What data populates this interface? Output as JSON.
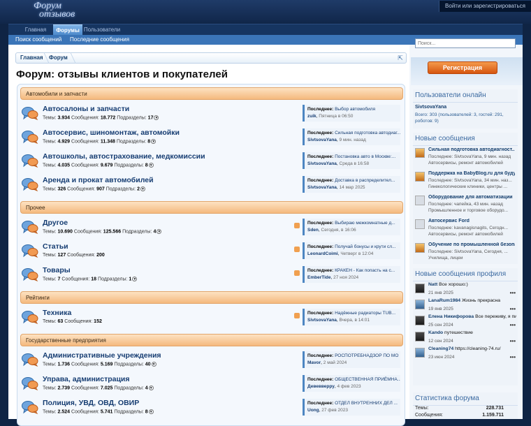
{
  "header": {
    "logo_line1": "Форум",
    "logo_line2": "отзывов",
    "login_link": "Войти или зарегистрироваться"
  },
  "nav": {
    "tabs": [
      {
        "label": "Главная"
      },
      {
        "label": "Форумы"
      },
      {
        "label": "Пользователи"
      }
    ],
    "sublinks": [
      {
        "label": "Поиск сообщений"
      },
      {
        "label": "Последние сообщения"
      }
    ]
  },
  "breadcrumb": {
    "items": [
      {
        "label": "Главная"
      },
      {
        "label": "Форум"
      }
    ]
  },
  "page_title": "Форум: отзывы клиентов и покупателей",
  "labels": {
    "threads": "Темы:",
    "messages": "Сообщения:",
    "subforums": "Подразделы:",
    "last": "Последнее:"
  },
  "categories": [
    {
      "title": "Автомобили и запчасти",
      "forums": [
        {
          "title": "Автосалоны и запчасти",
          "threads": "3.934",
          "messages": "18.772",
          "subforums": "17",
          "last_title": "Выбор автомобиля",
          "last_user": "zuik",
          "last_time": "Пятница в 06:50",
          "rss": false
        },
        {
          "title": "Автосервис, шиномонтаж, автомойки",
          "threads": "4.929",
          "messages": "11.348",
          "subforums": "8",
          "last_title": "Сильная подготовка автодиаг...",
          "last_user": "SivtsovaYana",
          "last_time": "9 мин. назад",
          "rss": false
        },
        {
          "title": "Автошколы, автострахование, медкомиссии",
          "threads": "4.035",
          "messages": "9.679",
          "subforums": "8",
          "last_title": "Постановка авто в Москве:...",
          "last_user": "SivtsovaYana",
          "last_time": "Среда в 16:58",
          "rss": false
        },
        {
          "title": "Аренда и прокат автомобилей",
          "threads": "326",
          "messages": "907",
          "subforums": "2",
          "last_title": "Доставка в распределител...",
          "last_user": "SivtsovaYana",
          "last_time": "14 мар 2025",
          "rss": false
        }
      ]
    },
    {
      "title": "Прочее",
      "forums": [
        {
          "title": "Другое",
          "threads": "10.690",
          "messages": "125.566",
          "subforums": "4",
          "last_title": "Выбираю межкомнатные д...",
          "last_user": "Sden",
          "last_time": "Сегодня, в 16:06",
          "rss": true
        },
        {
          "title": "Статьи",
          "threads": "127",
          "messages": "200",
          "subforums": "",
          "last_title": "Получай бонусы и крути сл...",
          "last_user": "LeonardCoimi",
          "last_time": "Четверг в 12:04",
          "rss": true
        },
        {
          "title": "Товары",
          "threads": "7",
          "messages": "18",
          "subforums": "1",
          "last_title": "КРАКЕН - Как попасть на с...",
          "last_user": "EmberTide",
          "last_time": "27 ноя 2024",
          "rss": true
        }
      ]
    },
    {
      "title": "Рейтинги",
      "forums": [
        {
          "title": "Техника",
          "threads": "63",
          "messages": "152",
          "subforums": "",
          "last_title": "Надёжные радиаторы TUB...",
          "last_user": "SivtsovaYana",
          "last_time": "Вчера, в 14:01",
          "rss": true
        }
      ]
    },
    {
      "title": "Государственные предприятия",
      "forums": [
        {
          "title": "Административные учреждения",
          "threads": "1.736",
          "messages": "5.169",
          "subforums": "40",
          "last_title": "РОСПОТРЕБНАДЗОР ПО МО",
          "last_user": "Mavor",
          "last_time": "2 май 2024",
          "rss": false
        },
        {
          "title": "Управа, администрация",
          "threads": "2.739",
          "messages": "7.025",
          "subforums": "4",
          "last_title": "ОБЩЕСТВЕННАЯ ПРИЁМНА...",
          "last_user": "Девевверру",
          "last_time": "4 фев 2023",
          "rss": false
        },
        {
          "title": "Полиция, УВД, ОВД, ОВИР",
          "threads": "2.524",
          "messages": "5.741",
          "subforums": "8",
          "last_title": "ОТДЕЛ ВНУТРЕННИХ ДЕЛ ...",
          "last_user": "Uong",
          "last_time": "27 фев 2023",
          "rss": false
        }
      ]
    }
  ],
  "sidebar": {
    "search_placeholder": "Поиск...",
    "register_label": "Регистрация",
    "online": {
      "title": "Пользователи онлайн",
      "names": "SivtsovaYana",
      "count": "Всего: 303 (пользователей: 3, гостей: 291, роботов: 9)"
    },
    "new_posts": {
      "title": "Новые сообщения",
      "items": [
        {
          "title": "Сильная подготовка автодиагност...",
          "line1": "Последнее: SivtsovaYana, 9 мин. назад",
          "line2": "Автосервисы, ремонт автомобилей",
          "thumb": "or"
        },
        {
          "title": "Поддержка на BabyBlog.ru для буду...",
          "line1": "Последнее: SivtsovaYana, 34 мин. наз...",
          "line2": "Гинекологические клиники, центры ...",
          "thumb": "or"
        },
        {
          "title": "Оборудование для автоматизации",
          "line1": "Последнее: чапейка, 43 мин. назад",
          "line2": "Промышленное и торговое оборудо...",
          "thumb": "gr"
        },
        {
          "title": "Автосервис Ford",
          "line1": "Последнее: kavanagisnagits, Сегодн...",
          "line2": "Автосервисы, ремонт автомобилей",
          "thumb": "gr"
        },
        {
          "title": "Обучение по промышленной безопа...",
          "line1": "Последнее: SivtsovaYana, Сегодня, ...",
          "line2": "Училища, лицеи",
          "thumb": "or"
        }
      ]
    },
    "profile_posts": {
      "title": "Новые сообщения профиля",
      "items": [
        {
          "user": "Natt",
          "text": "Все хорошо:)",
          "date": "21 янв 2025",
          "thumb": "dk"
        },
        {
          "user": "LanaRum1984",
          "text": "Жизнь прекрасна",
          "date": "19 янв 2025",
          "thumb": "bl"
        },
        {
          "user": "Елена Никифорова",
          "text": "Все переживу, я пити со себе сказала: сильной быть хочу...",
          "date": "25 сен 2024",
          "thumb": "dk"
        },
        {
          "user": "Kando",
          "text": "путешествие",
          "date": "12 сен 2024",
          "thumb": "dk"
        },
        {
          "user": "Cleaning74",
          "text": "https://cleaning-74.ru/",
          "date": "23 июн 2024",
          "thumb": "bl"
        }
      ]
    },
    "stats": {
      "title": "Статистика форума",
      "rows": [
        {
          "label": "Темы:",
          "value": "228.731"
        },
        {
          "label": "Сообщения:",
          "value": "1.159.711"
        }
      ]
    }
  },
  "colors": {
    "accent": "#3b75b8",
    "category_header": "#f4b97e",
    "register_button": "#e06a1f"
  }
}
